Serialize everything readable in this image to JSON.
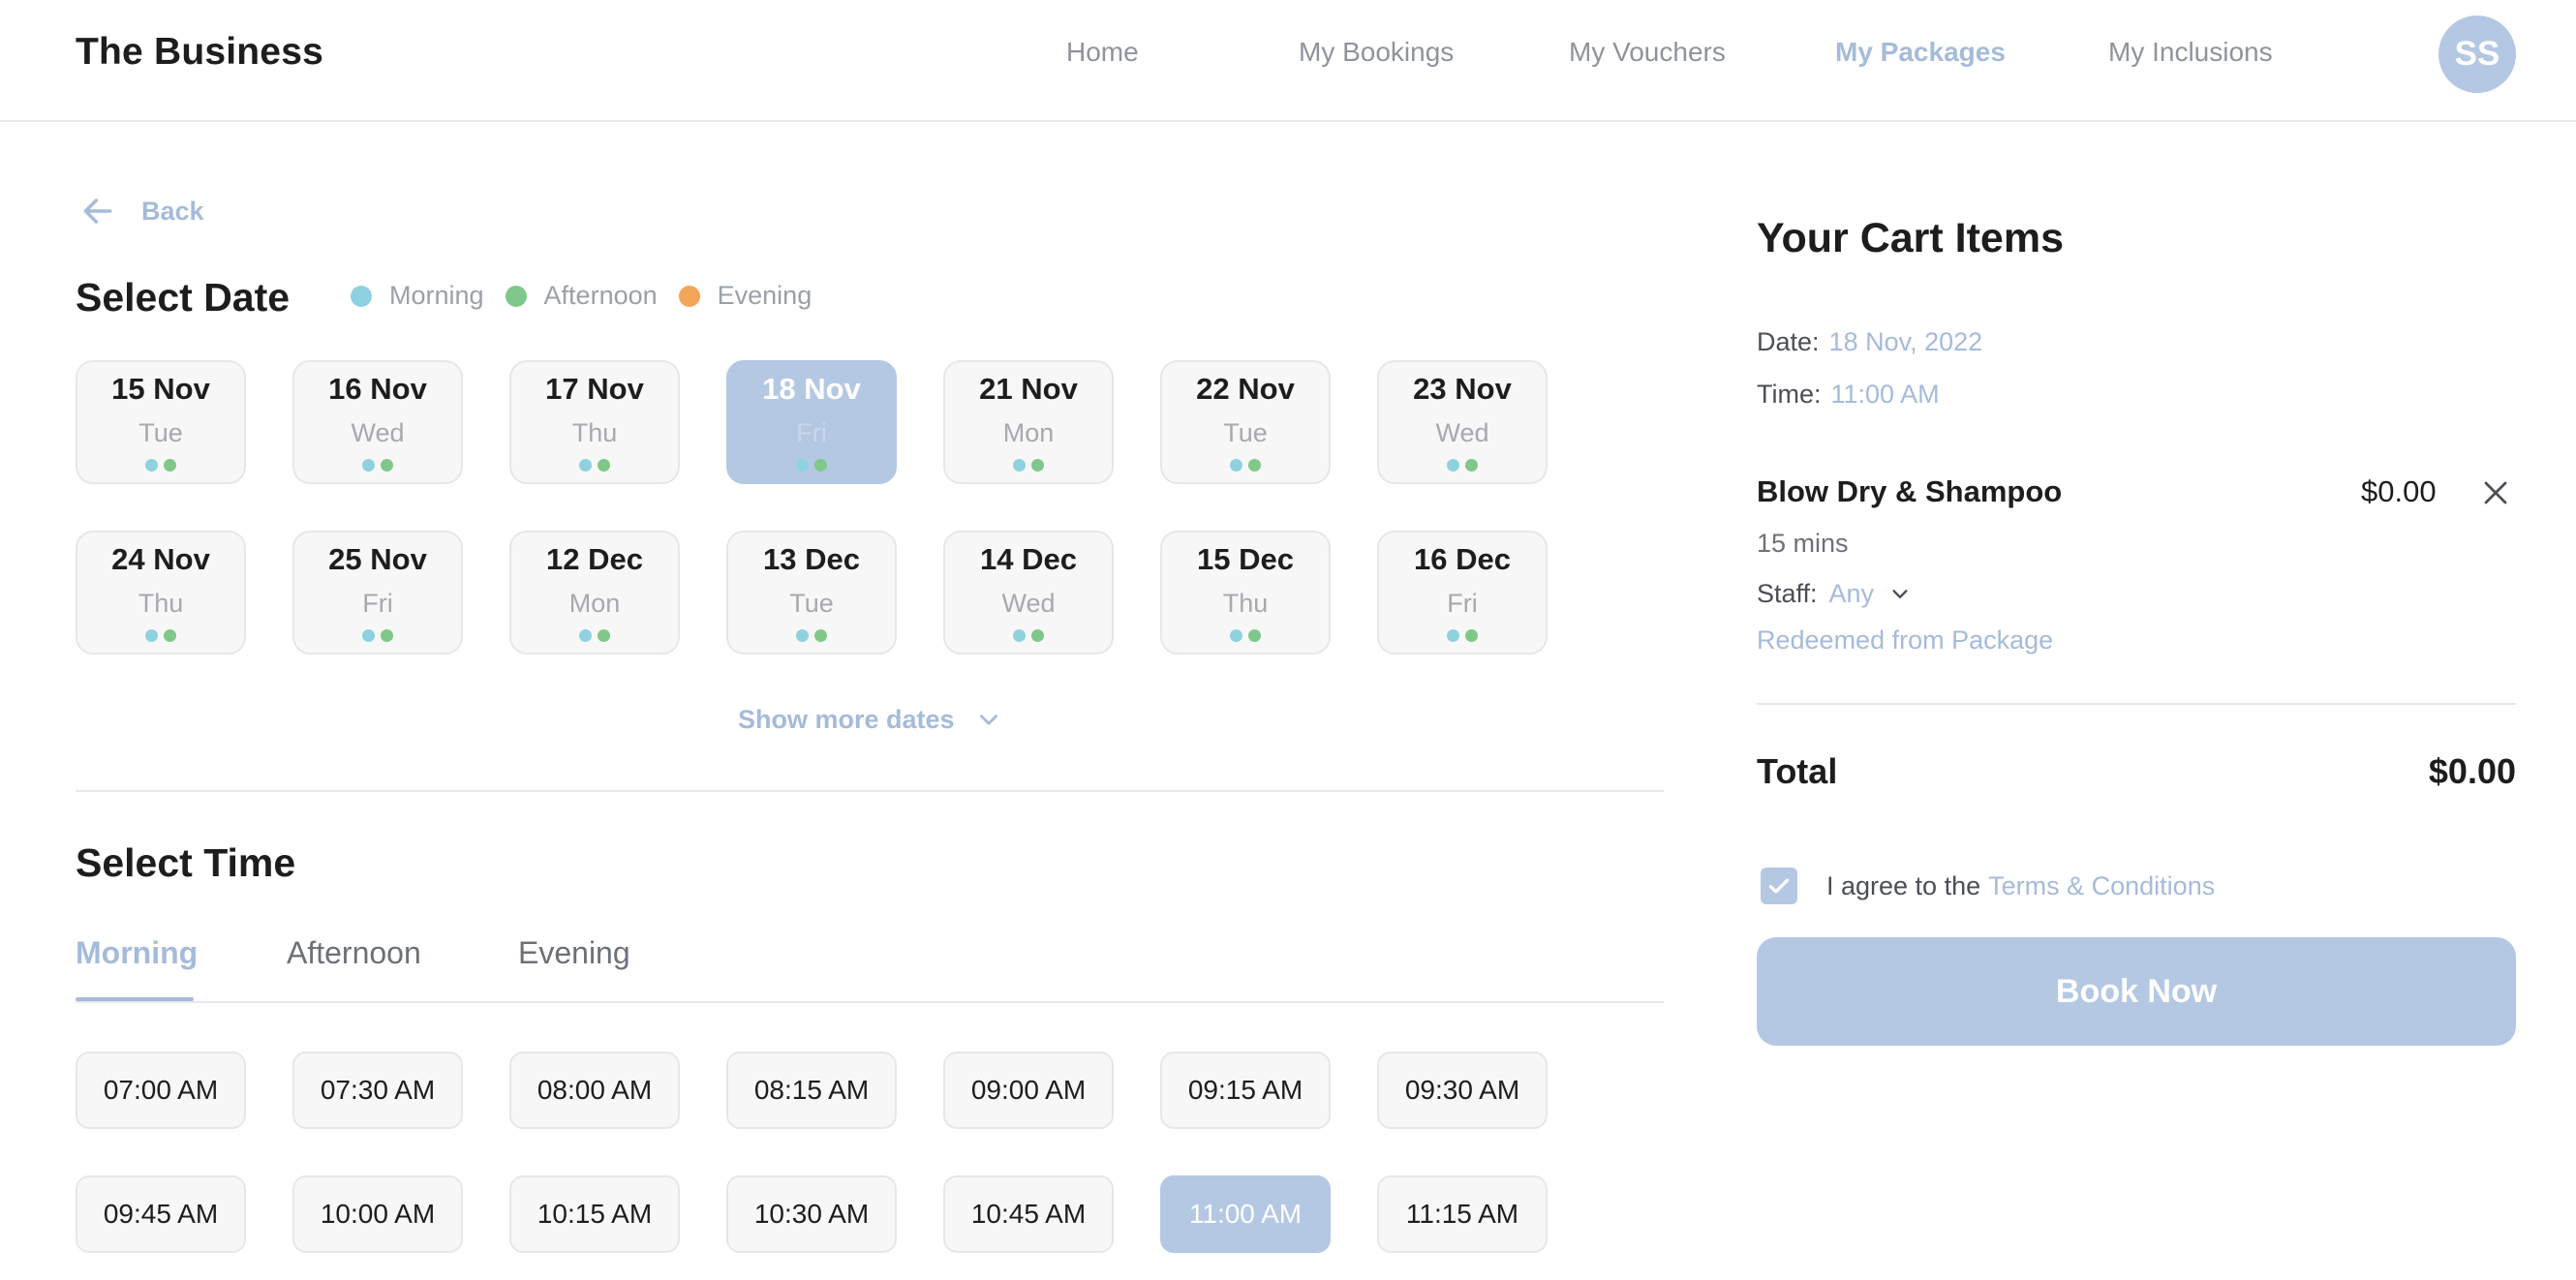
{
  "header": {
    "brand": "The Business",
    "nav": [
      {
        "label": "Home",
        "active": false
      },
      {
        "label": "My Bookings",
        "active": false
      },
      {
        "label": "My Vouchers",
        "active": false
      },
      {
        "label": "My Packages",
        "active": true
      },
      {
        "label": "My Inclusions",
        "active": false
      }
    ],
    "avatar_initials": "SS"
  },
  "back_label": "Back",
  "date_section": {
    "title": "Select Date",
    "legend": [
      {
        "label": "Morning",
        "color": "#8fd2df"
      },
      {
        "label": "Afternoon",
        "color": "#7fc88a"
      },
      {
        "label": "Evening",
        "color": "#f3a559"
      }
    ],
    "dates": [
      {
        "date": "15 Nov",
        "day": "Tue",
        "selected": false
      },
      {
        "date": "16 Nov",
        "day": "Wed",
        "selected": false
      },
      {
        "date": "17 Nov",
        "day": "Thu",
        "selected": false
      },
      {
        "date": "18 Nov",
        "day": "Fri",
        "selected": true
      },
      {
        "date": "21 Nov",
        "day": "Mon",
        "selected": false
      },
      {
        "date": "22 Nov",
        "day": "Tue",
        "selected": false
      },
      {
        "date": "23 Nov",
        "day": "Wed",
        "selected": false
      },
      {
        "date": "24 Nov",
        "day": "Thu",
        "selected": false
      },
      {
        "date": "25 Nov",
        "day": "Fri",
        "selected": false
      },
      {
        "date": "12 Dec",
        "day": "Mon",
        "selected": false
      },
      {
        "date": "13 Dec",
        "day": "Tue",
        "selected": false
      },
      {
        "date": "14 Dec",
        "day": "Wed",
        "selected": false
      },
      {
        "date": "15 Dec",
        "day": "Thu",
        "selected": false
      },
      {
        "date": "16 Dec",
        "day": "Fri",
        "selected": false
      }
    ],
    "show_more": "Show more dates"
  },
  "time_section": {
    "title": "Select Time",
    "tabs": [
      {
        "label": "Morning",
        "active": true
      },
      {
        "label": "Afternoon",
        "active": false
      },
      {
        "label": "Evening",
        "active": false
      }
    ],
    "slots": [
      {
        "time": "07:00 AM",
        "selected": false
      },
      {
        "time": "07:30 AM",
        "selected": false
      },
      {
        "time": "08:00 AM",
        "selected": false
      },
      {
        "time": "08:15 AM",
        "selected": false
      },
      {
        "time": "09:00 AM",
        "selected": false
      },
      {
        "time": "09:15 AM",
        "selected": false
      },
      {
        "time": "09:30 AM",
        "selected": false
      },
      {
        "time": "09:45 AM",
        "selected": false
      },
      {
        "time": "10:00 AM",
        "selected": false
      },
      {
        "time": "10:15 AM",
        "selected": false
      },
      {
        "time": "10:30 AM",
        "selected": false
      },
      {
        "time": "10:45 AM",
        "selected": false
      },
      {
        "time": "11:00 AM",
        "selected": true
      },
      {
        "time": "11:15 AM",
        "selected": false
      }
    ]
  },
  "cart": {
    "title": "Your Cart Items",
    "date_label": "Date:",
    "date_value": "18 Nov, 2022",
    "time_label": "Time:",
    "time_value": "11:00 AM",
    "item": {
      "name": "Blow Dry & Shampoo",
      "price": "$0.00",
      "duration": "15 mins",
      "staff_label": "Staff:",
      "staff_value": "Any",
      "note": "Redeemed from Package"
    },
    "total_label": "Total",
    "total_value": "$0.00",
    "agree_text": "I agree to the",
    "terms_link": "Terms & Conditions",
    "agree_checked": true,
    "book_button": "Book Now"
  },
  "colors": {
    "accent": "#a5bbd9",
    "accent_fill": "#b4c8e3",
    "morning": "#8fd2df",
    "afternoon": "#7fc88a",
    "evening": "#f3a559"
  }
}
